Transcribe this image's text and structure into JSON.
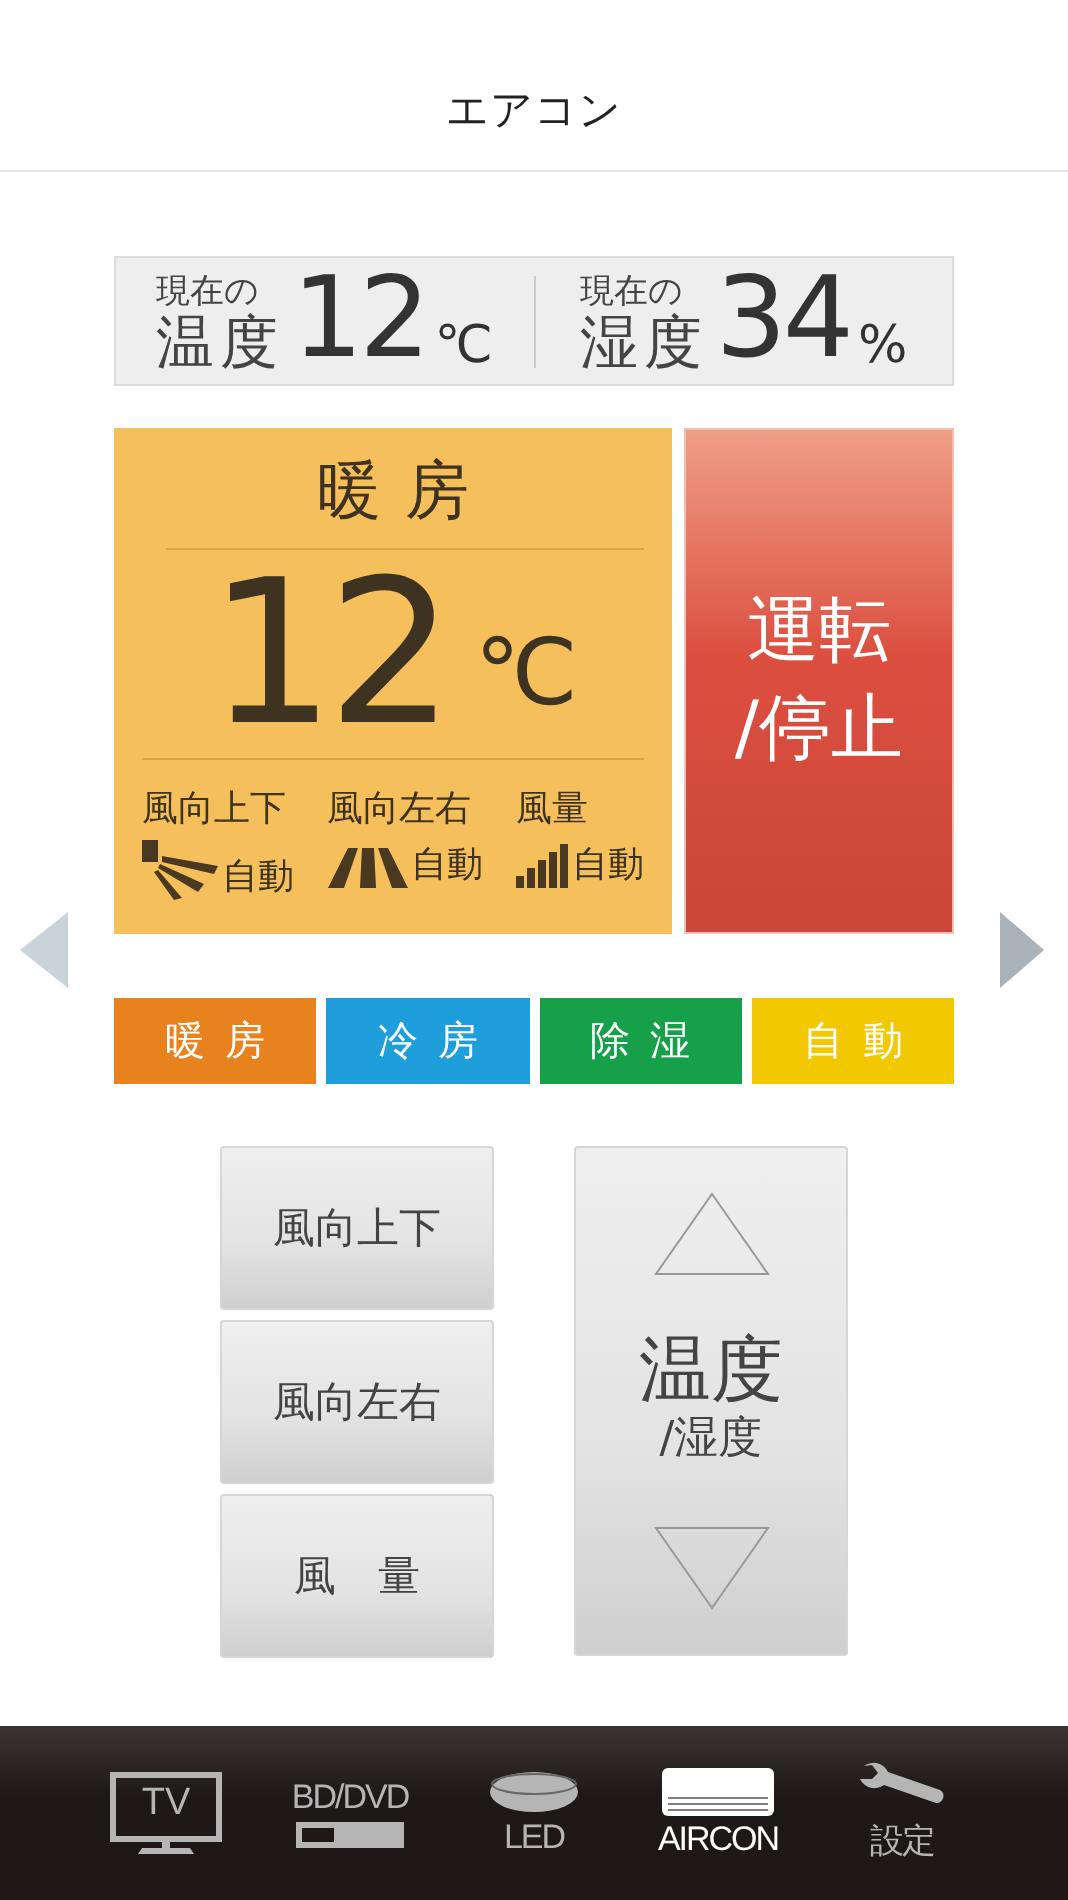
{
  "header": {
    "title": "エアコン"
  },
  "readings": [
    {
      "caption_top": "現在の",
      "caption_bottom": "温度",
      "value": "12",
      "unit": "℃"
    },
    {
      "caption_top": "現在の",
      "caption_bottom": "湿度",
      "value": "34",
      "unit": "%"
    }
  ],
  "status": {
    "mode": "暖房",
    "temperature": "12",
    "unit": "℃",
    "settings": [
      {
        "kind": "vertical",
        "label": "風向上下",
        "value": "自動"
      },
      {
        "kind": "horizontal",
        "label": "風向左右",
        "value": "自動"
      },
      {
        "kind": "volume",
        "label": "風量",
        "value": "自動"
      }
    ]
  },
  "power_button": {
    "line1": "運転",
    "line2": "/停止"
  },
  "modes": [
    {
      "label": "暖房",
      "color": "#e8821e"
    },
    {
      "label": "冷房",
      "color": "#1e9fdc"
    },
    {
      "label": "除湿",
      "color": "#17a04a"
    },
    {
      "label": "自動",
      "color": "#f2c800"
    }
  ],
  "controls": [
    {
      "label": "風向上下"
    },
    {
      "label": "風向左右"
    },
    {
      "label": "風　量"
    }
  ],
  "temp_button": {
    "title": "温度",
    "subtitle": "/湿度"
  },
  "nav": [
    {
      "kind": "tv",
      "label": "TV",
      "selected": false
    },
    {
      "kind": "disc",
      "label": "BD/DVD",
      "selected": false
    },
    {
      "kind": "led",
      "label": "LED",
      "selected": false
    },
    {
      "kind": "aircon",
      "label": "AIRCON",
      "selected": true
    },
    {
      "kind": "settings",
      "label": "設定",
      "selected": false
    }
  ]
}
